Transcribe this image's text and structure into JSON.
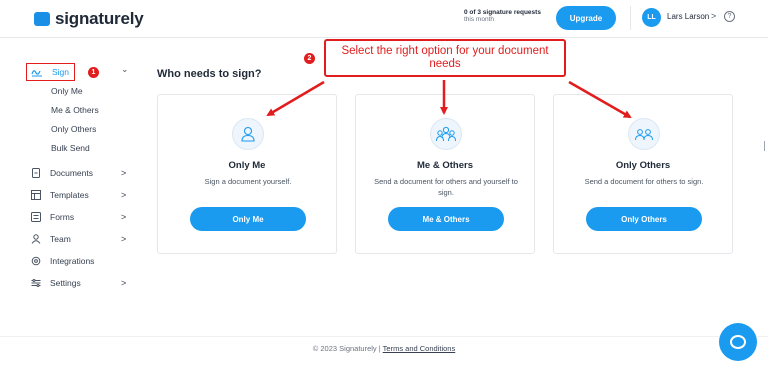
{
  "header": {
    "logo": "signaturely",
    "requests": "0 of 3 signature requests",
    "requests_period": "this month",
    "upgrade_label": "Upgrade",
    "avatar_initials": "LL",
    "user_name": "Lars Larson",
    "user_chevron": ">",
    "help": "?"
  },
  "sidebar": {
    "sign": "Sign",
    "sign_badge": "1",
    "sub_items": [
      "Only Me",
      "Me & Others",
      "Only Others",
      "Bulk Send"
    ],
    "items": [
      {
        "label": "Documents",
        "icon": "document-icon"
      },
      {
        "label": "Templates",
        "icon": "templates-icon"
      },
      {
        "label": "Forms",
        "icon": "forms-icon"
      },
      {
        "label": "Team",
        "icon": "team-icon"
      },
      {
        "label": "Integrations",
        "icon": "integrations-icon"
      },
      {
        "label": "Settings",
        "icon": "settings-icon"
      }
    ],
    "chevron_down": "⌄",
    "chevron_right": ">"
  },
  "main": {
    "title": "Who needs to sign?",
    "cards": [
      {
        "title": "Only Me",
        "desc": "Sign a document yourself.",
        "button": "Only Me",
        "icon": "person-icon"
      },
      {
        "title": "Me & Others",
        "desc": "Send a document for others and yourself to sign.",
        "button": "Me & Others",
        "icon": "group-icon"
      },
      {
        "title": "Only Others",
        "desc": "Send a document for others to sign.",
        "button": "Only Others",
        "icon": "others-icon"
      }
    ]
  },
  "annotation": {
    "callout": "Select the right option for your document needs",
    "badge": "2",
    "color": "#e11d1d"
  },
  "footer": {
    "copyright": "© 2023 Signaturely | ",
    "terms": "Terms and Conditions"
  },
  "colors": {
    "accent": "#1a9bf0",
    "annotation": "#e11d1d"
  }
}
